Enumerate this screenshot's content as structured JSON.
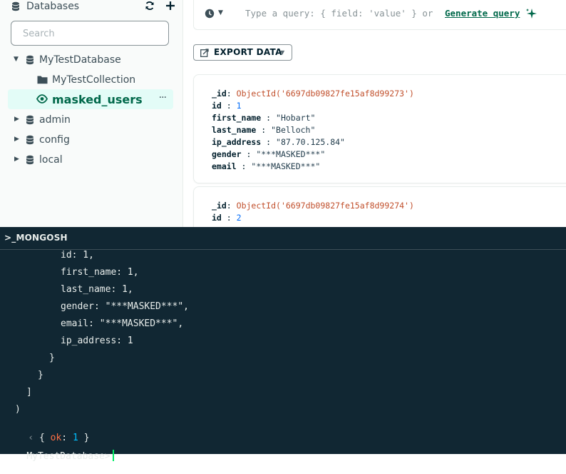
{
  "sidebar": {
    "title": "Databases",
    "search_placeholder": "Search",
    "databases": [
      {
        "name": "MyTestDatabase",
        "expanded": true,
        "children": [
          {
            "name": "MyTestCollection",
            "icon": "folder-icon"
          },
          {
            "name": "masked_users",
            "icon": "eye-icon",
            "active": true
          }
        ]
      },
      {
        "name": "admin",
        "expanded": false
      },
      {
        "name": "config",
        "expanded": false
      },
      {
        "name": "local",
        "expanded": false
      }
    ],
    "more_label": "···"
  },
  "query": {
    "placeholder": "Type a query: { field: 'value' } or",
    "generate_label": "Generate query"
  },
  "toolbar": {
    "export_label": "EXPORT DATA"
  },
  "documents": [
    {
      "fields": [
        {
          "key": "_id",
          "type": "oid",
          "value": "ObjectId('6697db09827fe15af8d99273')"
        },
        {
          "key": "id",
          "type": "num",
          "value": "1"
        },
        {
          "key": "first_name",
          "type": "str",
          "value": "\"Hobart\""
        },
        {
          "key": "last_name",
          "type": "str",
          "value": "\"Belloch\""
        },
        {
          "key": "ip_address",
          "type": "str",
          "value": "\"87.70.125.84\""
        },
        {
          "key": "gender",
          "type": "str",
          "value": "\"***MASKED***\""
        },
        {
          "key": "email",
          "type": "str",
          "value": "\"***MASKED***\""
        }
      ]
    },
    {
      "fields": [
        {
          "key": "_id",
          "type": "oid",
          "value": "ObjectId('6697db09827fe15af8d99274')"
        },
        {
          "key": "id",
          "type": "num",
          "value": "2"
        }
      ]
    }
  ],
  "shell": {
    "title": ">_MONGOSH",
    "lines": [
      "id: 1,",
      "first_name: 1,",
      "last_name: 1,",
      "gender: \"***MASKED***\",",
      "email: \"***MASKED***\",",
      "ip_address: 1",
      "}",
      "}",
      "]",
      ")"
    ],
    "result_open": "{ ",
    "result_key": "ok",
    "result_sep": ": ",
    "result_val": "1",
    "result_close": " }",
    "prompt": "MyTestDatabase>"
  },
  "colors": {
    "accent": "#00684a",
    "active_bg": "#e3fcf7",
    "shell_bg": "#112733",
    "oid": "#c14f2b",
    "number": "#016bf8"
  }
}
